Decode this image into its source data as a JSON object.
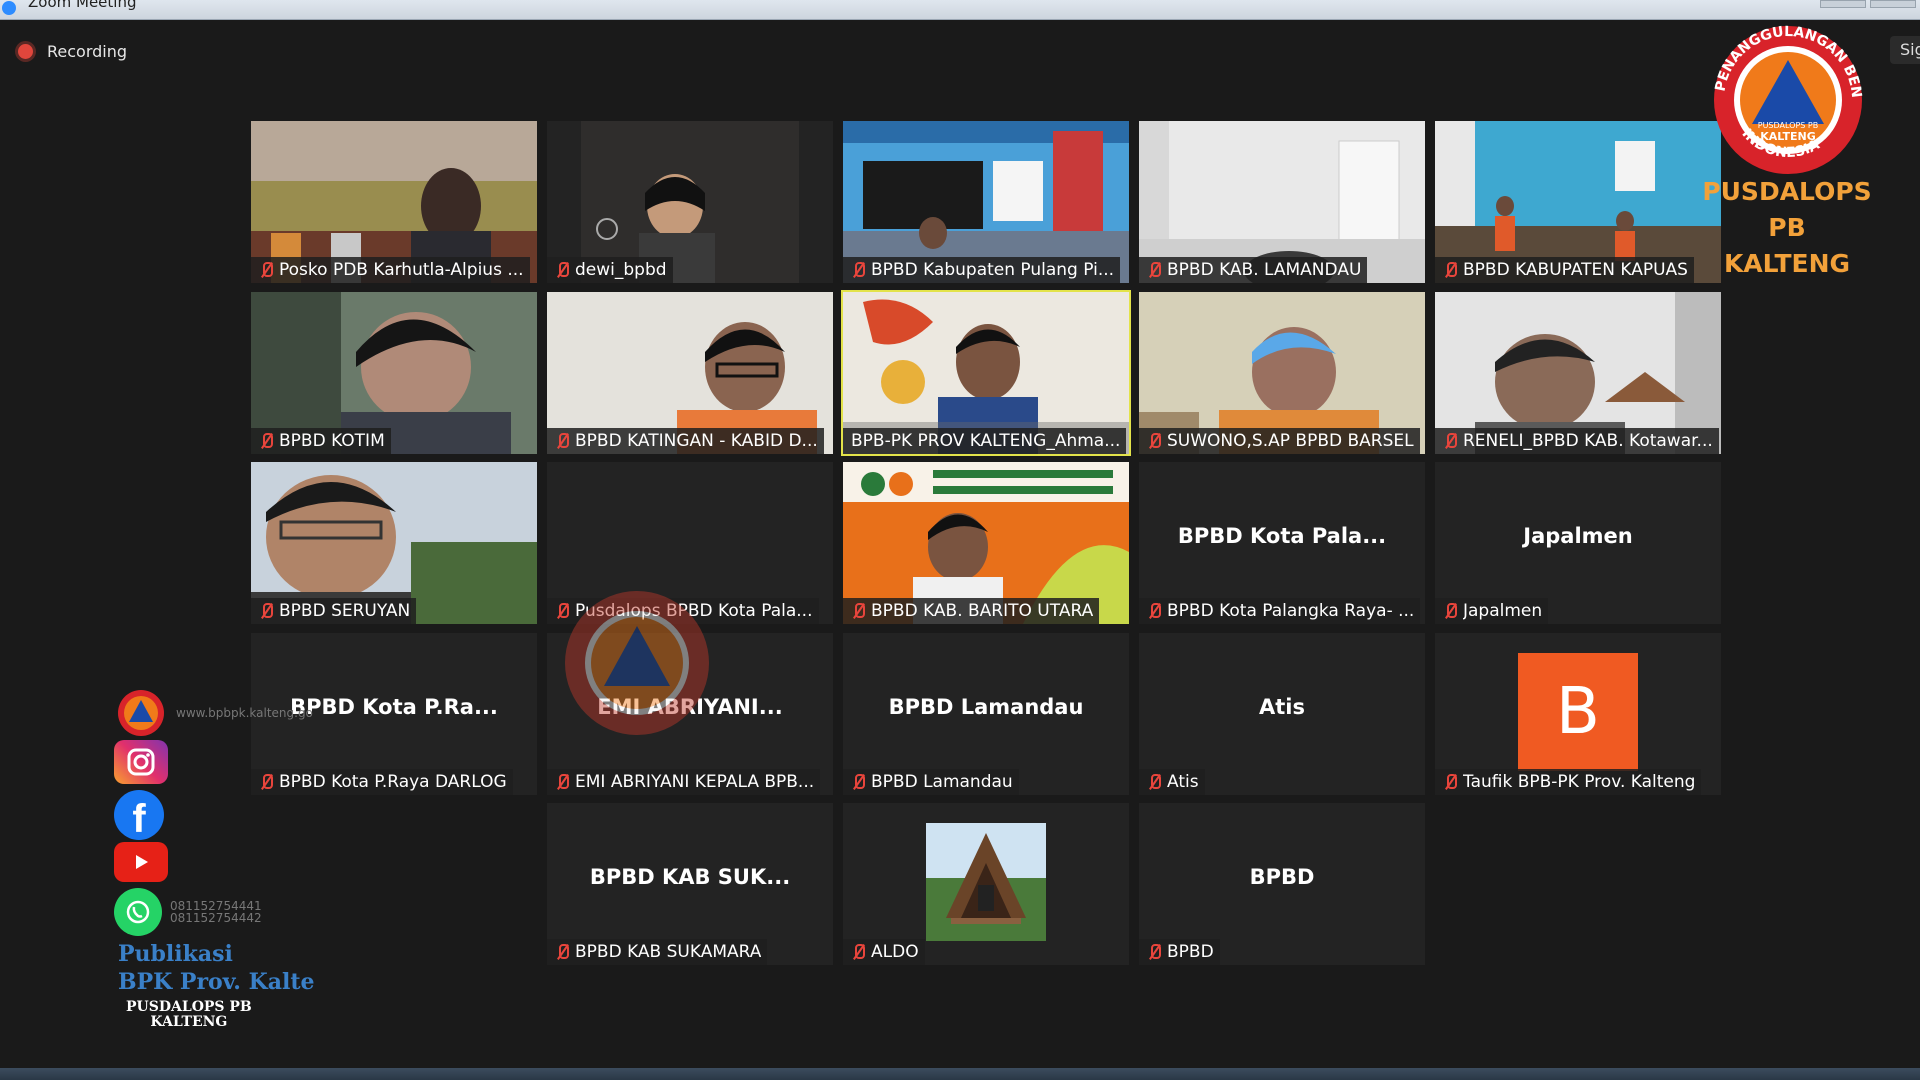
{
  "window": {
    "title": "Zoom Meeting"
  },
  "recording": {
    "label": "Recording"
  },
  "sign_button": {
    "label": "Sig"
  },
  "branding": {
    "logo_ring_text": "PENANGGULANGAN BENCANA",
    "logo_inner_top": "PUSDALOPS PB",
    "logo_inner_bottom": "KALTENG",
    "logo_country": "INDONESIA",
    "logo_line1": "PUSDALOPS PB",
    "logo_line2": "KALTENG",
    "publikasi_line1": "Publikasi",
    "publikasi_line2": "BPK Prov. Kalte",
    "pusdalops_line1": "PUSDALOPS PB",
    "pusdalops_line2": "KALTENG",
    "website": "www.bpbpk.kalteng.go",
    "whatsapp_1": "081152754441",
    "whatsapp_2": "081152754442"
  },
  "participants": [
    {
      "name": "Posko PDB Karhutla-Alpius ...",
      "big": ""
    },
    {
      "name": "dewi_bpbd",
      "big": ""
    },
    {
      "name": "BPBD Kabupaten Pulang Pi...",
      "big": ""
    },
    {
      "name": "BPBD KAB. LAMANDAU",
      "big": ""
    },
    {
      "name": "BPBD KABUPATEN KAPUAS",
      "big": ""
    },
    {
      "name": "BPBD KOTIM",
      "big": ""
    },
    {
      "name": "BPBD KATINGAN - KABID D...",
      "big": ""
    },
    {
      "name": "BPB-PK PROV KALTENG_Ahma...",
      "big": ""
    },
    {
      "name": "SUWONO,S.AP BPBD BARSEL",
      "big": ""
    },
    {
      "name": "RENELI_BPBD KAB. Kotawar...",
      "big": ""
    },
    {
      "name": "BPBD SERUYAN",
      "big": ""
    },
    {
      "name": "Pusdalops BPBD Kota Pala...",
      "big": ""
    },
    {
      "name": "BPBD KAB. BARITO UTARA",
      "big": ""
    },
    {
      "name": "BPBD Kota Palangka Raya- ...",
      "big": "BPBD Kota Pala..."
    },
    {
      "name": "Japalmen",
      "big": "Japalmen"
    },
    {
      "name": "BPBD Kota P.Raya DARLOG",
      "big": "BPBD Kota P.Ra..."
    },
    {
      "name": "EMI ABRIYANI KEPALA BPB...",
      "big": "EMI ABRIYANI..."
    },
    {
      "name": "BPBD Lamandau",
      "big": "BPBD Lamandau"
    },
    {
      "name": "Atis",
      "big": "Atis"
    },
    {
      "name": "Taufik BPB-PK Prov. Kalteng",
      "big": "",
      "avatar": "B"
    },
    {
      "name": "BPBD KAB SUKAMARA",
      "big": "BPBD KAB SUK..."
    },
    {
      "name": "ALDO",
      "big": ""
    },
    {
      "name": "BPBD",
      "big": "BPBD"
    }
  ],
  "colors": {
    "active_border": "#e3e34a",
    "mute_red": "#e8453c",
    "avatar_orange": "#f05a22"
  }
}
